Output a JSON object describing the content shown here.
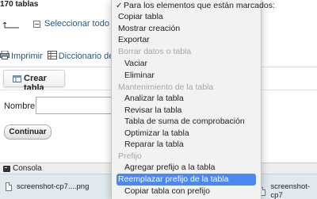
{
  "page": {
    "tables_count": "170 tablas",
    "select_all": "Seleccionar todo",
    "print": "Imprimir",
    "data_dictionary": "Diccionario de datos",
    "create_table": "Crear tabla",
    "name_label": "Nombre:",
    "continue": "Continuar",
    "console": "Consola"
  },
  "downloads": [
    {
      "name": "screenshot-cp7....png"
    },
    {
      "name": "screenshot-cp7"
    }
  ],
  "menu": {
    "title": "Para los elementos que están marcados:",
    "items": [
      {
        "label": "Copiar tabla",
        "kind": "item"
      },
      {
        "label": "Mostrar creación",
        "kind": "item"
      },
      {
        "label": "Exportar",
        "kind": "item"
      },
      {
        "label": "Borrar datos o tabla",
        "kind": "header"
      },
      {
        "label": "Vaciar",
        "kind": "indent"
      },
      {
        "label": "Eliminar",
        "kind": "indent"
      },
      {
        "label": "Mantenimiento de la tabla",
        "kind": "header"
      },
      {
        "label": "Analizar la tabla",
        "kind": "indent"
      },
      {
        "label": "Revisar la tabla",
        "kind": "indent"
      },
      {
        "label": "Tabla de suma de comprobación",
        "kind": "indent"
      },
      {
        "label": "Optimizar la tabla",
        "kind": "indent"
      },
      {
        "label": "Reparar la tabla",
        "kind": "indent"
      },
      {
        "label": "Prefijo",
        "kind": "header"
      },
      {
        "label": "Agregar prefijo a la tabla",
        "kind": "indent"
      },
      {
        "label": "Reemplazar prefijo de la tabla",
        "kind": "selected"
      },
      {
        "label": "Copiar tabla con prefijo",
        "kind": "indent"
      }
    ]
  },
  "colors": {
    "link": "#235a81",
    "menu_bg": "#f2f2f2",
    "menu_header": "#a6a6a6",
    "menu_selected": "#4b88f2",
    "downloads_bg": "#dfe9ee"
  }
}
